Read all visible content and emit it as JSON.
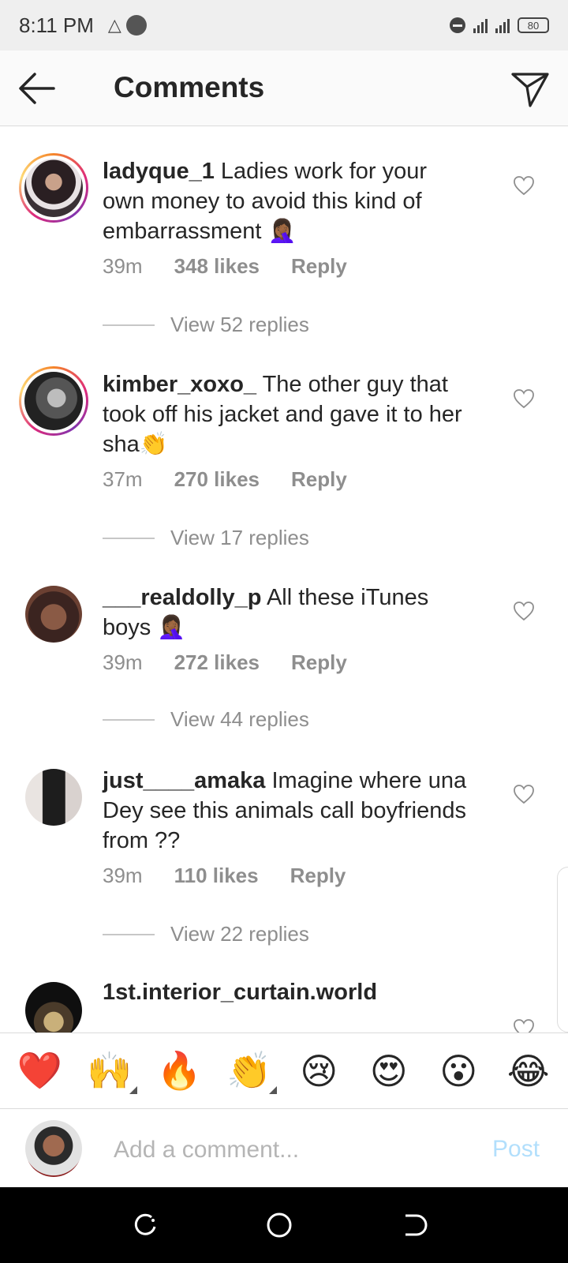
{
  "status_bar": {
    "time": "8:11 PM",
    "battery": "80"
  },
  "header": {
    "title": "Comments"
  },
  "comments": [
    {
      "username": "ladyque_1",
      "text": "Ladies work for your own money to avoid this kind of embarrassment 🤦🏾‍♀️",
      "time": "39m",
      "likes": "348 likes",
      "reply": "Reply",
      "view_replies": "View 52 replies"
    },
    {
      "username": "kimber_xoxo_",
      "text": "The other guy that took off his jacket and gave it to her sha👏",
      "time": "37m",
      "likes": "270 likes",
      "reply": "Reply",
      "view_replies": "View 17 replies"
    },
    {
      "username": "___realdolly_p",
      "text": "All these iTunes boys 🤦🏾‍♀️",
      "time": "39m",
      "likes": "272 likes",
      "reply": "Reply",
      "view_replies": "View 44 replies"
    },
    {
      "username": "just____amaka",
      "text": "Imagine where una Dey see this animals call boyfriends from ??",
      "time": "39m",
      "likes": "110 likes",
      "reply": "Reply",
      "view_replies": "View 22 replies"
    },
    {
      "username": "1st.interior_curtain.world"
    }
  ],
  "emoji_bar": [
    "❤️",
    "🙌",
    "🔥",
    "👏",
    "😢",
    "😍",
    "😮",
    "😂"
  ],
  "composer": {
    "placeholder": "Add a comment...",
    "post_label": "Post"
  },
  "colors": {
    "link_disabled": "#b2dffc",
    "secondary_text": "#8e8e8e",
    "heart_red": "#ed4956"
  }
}
